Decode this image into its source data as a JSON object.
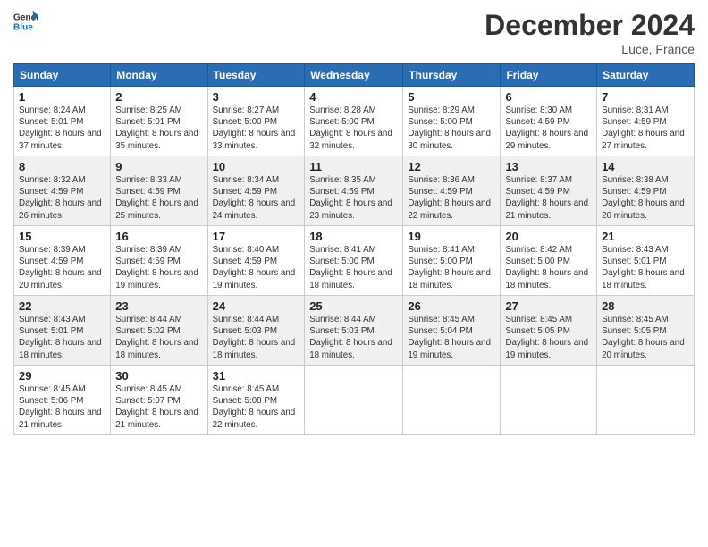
{
  "header": {
    "logo_line1": "General",
    "logo_line2": "Blue",
    "month": "December 2024",
    "location": "Luce, France"
  },
  "days_of_week": [
    "Sunday",
    "Monday",
    "Tuesday",
    "Wednesday",
    "Thursday",
    "Friday",
    "Saturday"
  ],
  "weeks": [
    [
      {
        "day": "1",
        "sunrise": "8:24 AM",
        "sunset": "5:01 PM",
        "daylight": "8 hours and 37 minutes."
      },
      {
        "day": "2",
        "sunrise": "8:25 AM",
        "sunset": "5:01 PM",
        "daylight": "8 hours and 35 minutes."
      },
      {
        "day": "3",
        "sunrise": "8:27 AM",
        "sunset": "5:00 PM",
        "daylight": "8 hours and 33 minutes."
      },
      {
        "day": "4",
        "sunrise": "8:28 AM",
        "sunset": "5:00 PM",
        "daylight": "8 hours and 32 minutes."
      },
      {
        "day": "5",
        "sunrise": "8:29 AM",
        "sunset": "5:00 PM",
        "daylight": "8 hours and 30 minutes."
      },
      {
        "day": "6",
        "sunrise": "8:30 AM",
        "sunset": "4:59 PM",
        "daylight": "8 hours and 29 minutes."
      },
      {
        "day": "7",
        "sunrise": "8:31 AM",
        "sunset": "4:59 PM",
        "daylight": "8 hours and 27 minutes."
      }
    ],
    [
      {
        "day": "8",
        "sunrise": "8:32 AM",
        "sunset": "4:59 PM",
        "daylight": "8 hours and 26 minutes."
      },
      {
        "day": "9",
        "sunrise": "8:33 AM",
        "sunset": "4:59 PM",
        "daylight": "8 hours and 25 minutes."
      },
      {
        "day": "10",
        "sunrise": "8:34 AM",
        "sunset": "4:59 PM",
        "daylight": "8 hours and 24 minutes."
      },
      {
        "day": "11",
        "sunrise": "8:35 AM",
        "sunset": "4:59 PM",
        "daylight": "8 hours and 23 minutes."
      },
      {
        "day": "12",
        "sunrise": "8:36 AM",
        "sunset": "4:59 PM",
        "daylight": "8 hours and 22 minutes."
      },
      {
        "day": "13",
        "sunrise": "8:37 AM",
        "sunset": "4:59 PM",
        "daylight": "8 hours and 21 minutes."
      },
      {
        "day": "14",
        "sunrise": "8:38 AM",
        "sunset": "4:59 PM",
        "daylight": "8 hours and 20 minutes."
      }
    ],
    [
      {
        "day": "15",
        "sunrise": "8:39 AM",
        "sunset": "4:59 PM",
        "daylight": "8 hours and 20 minutes."
      },
      {
        "day": "16",
        "sunrise": "8:39 AM",
        "sunset": "4:59 PM",
        "daylight": "8 hours and 19 minutes."
      },
      {
        "day": "17",
        "sunrise": "8:40 AM",
        "sunset": "4:59 PM",
        "daylight": "8 hours and 19 minutes."
      },
      {
        "day": "18",
        "sunrise": "8:41 AM",
        "sunset": "5:00 PM",
        "daylight": "8 hours and 18 minutes."
      },
      {
        "day": "19",
        "sunrise": "8:41 AM",
        "sunset": "5:00 PM",
        "daylight": "8 hours and 18 minutes."
      },
      {
        "day": "20",
        "sunrise": "8:42 AM",
        "sunset": "5:00 PM",
        "daylight": "8 hours and 18 minutes."
      },
      {
        "day": "21",
        "sunrise": "8:43 AM",
        "sunset": "5:01 PM",
        "daylight": "8 hours and 18 minutes."
      }
    ],
    [
      {
        "day": "22",
        "sunrise": "8:43 AM",
        "sunset": "5:01 PM",
        "daylight": "8 hours and 18 minutes."
      },
      {
        "day": "23",
        "sunrise": "8:44 AM",
        "sunset": "5:02 PM",
        "daylight": "8 hours and 18 minutes."
      },
      {
        "day": "24",
        "sunrise": "8:44 AM",
        "sunset": "5:03 PM",
        "daylight": "8 hours and 18 minutes."
      },
      {
        "day": "25",
        "sunrise": "8:44 AM",
        "sunset": "5:03 PM",
        "daylight": "8 hours and 18 minutes."
      },
      {
        "day": "26",
        "sunrise": "8:45 AM",
        "sunset": "5:04 PM",
        "daylight": "8 hours and 19 minutes."
      },
      {
        "day": "27",
        "sunrise": "8:45 AM",
        "sunset": "5:05 PM",
        "daylight": "8 hours and 19 minutes."
      },
      {
        "day": "28",
        "sunrise": "8:45 AM",
        "sunset": "5:05 PM",
        "daylight": "8 hours and 20 minutes."
      }
    ],
    [
      {
        "day": "29",
        "sunrise": "8:45 AM",
        "sunset": "5:06 PM",
        "daylight": "8 hours and 21 minutes."
      },
      {
        "day": "30",
        "sunrise": "8:45 AM",
        "sunset": "5:07 PM",
        "daylight": "8 hours and 21 minutes."
      },
      {
        "day": "31",
        "sunrise": "8:45 AM",
        "sunset": "5:08 PM",
        "daylight": "8 hours and 22 minutes."
      },
      null,
      null,
      null,
      null
    ]
  ],
  "labels": {
    "sunrise": "Sunrise:",
    "sunset": "Sunset:",
    "daylight": "Daylight:"
  }
}
